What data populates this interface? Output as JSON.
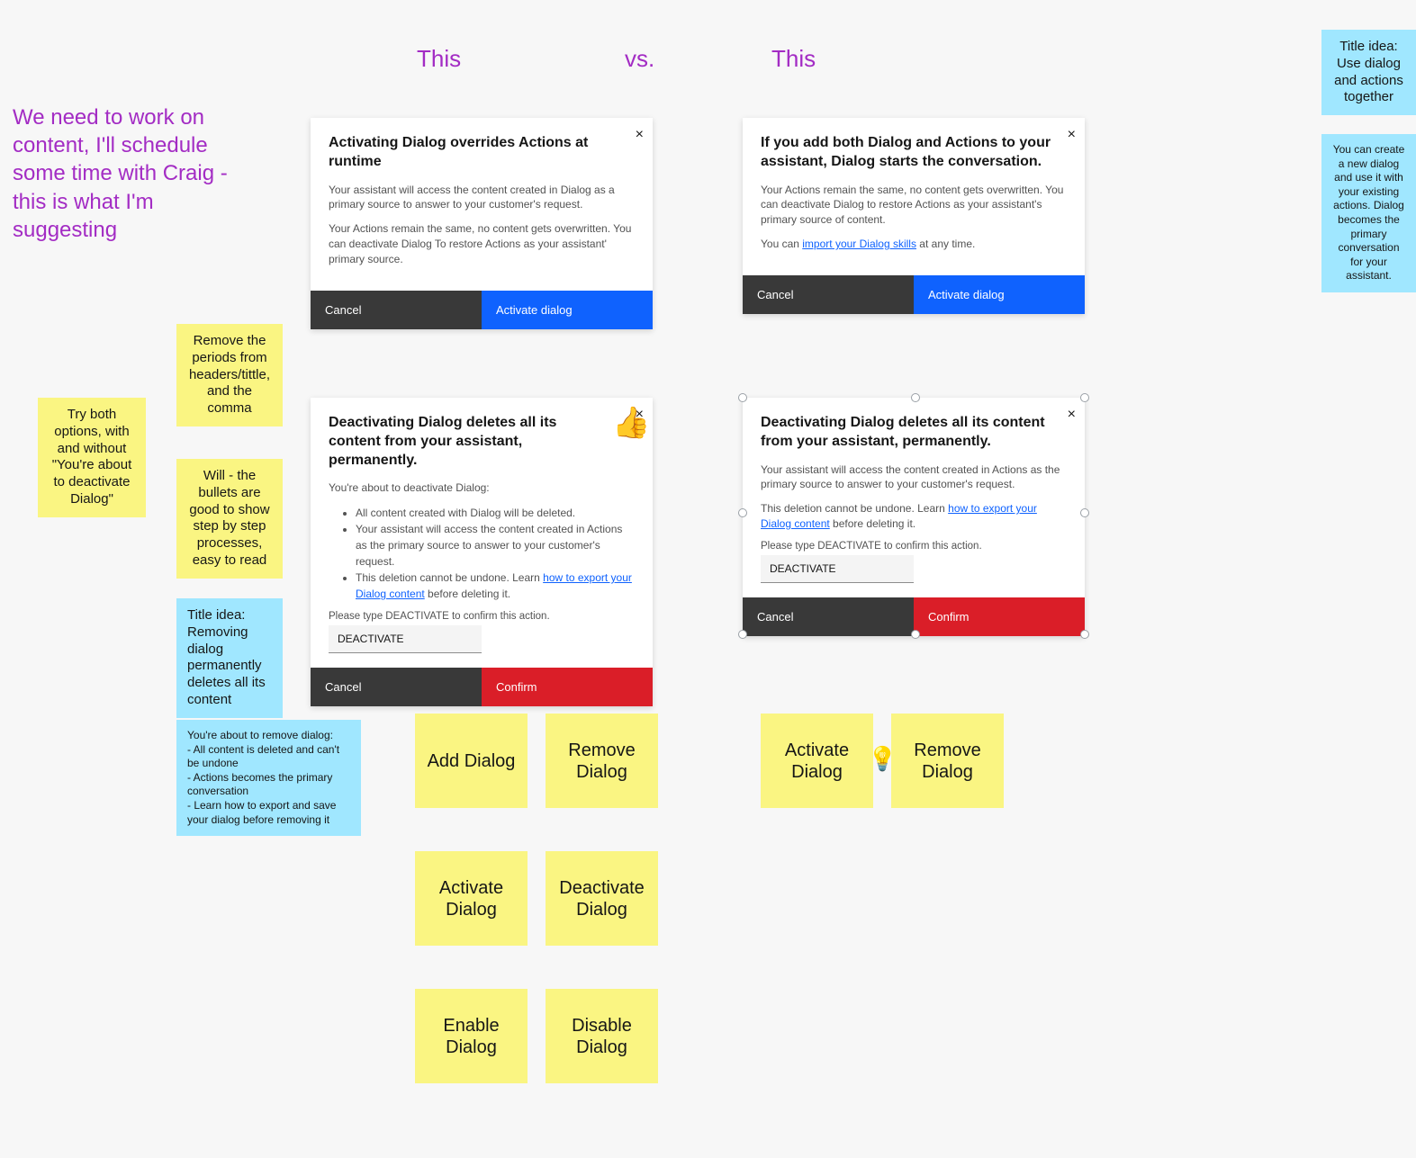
{
  "header": {
    "this_left": "This",
    "vs": "vs.",
    "this_right": "This"
  },
  "left_note": "We need to work on content, I'll schedule some time with Craig - this is what I'm suggesting",
  "sticky_title_right": "Title idea: Use dialog and actions together",
  "sticky_body_right": "You can create a new dialog and use it with your existing actions. Dialog becomes the primary conversation for your assistant.",
  "sticky_remove_periods": "Remove the periods from headers/tittle, and the comma",
  "sticky_try_both": "Try both options, with and without \"You're about to deactivate Dialog\"",
  "sticky_will_bullets": "Will - the bullets are good to show step by step processes, easy to read",
  "sticky_title_remove": "Title idea: Removing dialog permanently deletes all its content",
  "sticky_body_remove": "You're about to remove dialog:\n- All content is deleted and can't be undone\n- Actions becomes the primary conversation\n- Learn how to export and save your dialog before removing it",
  "modalA": {
    "title": "Activating Dialog overrides Actions at runtime",
    "p1": "Your assistant will access the content created in Dialog as a primary source to answer to your customer's request.",
    "p2": "Your Actions remain the same, no content gets overwritten. You can deactivate Dialog To restore Actions as your assistant' primary source.",
    "cancel": "Cancel",
    "primary": "Activate dialog"
  },
  "modalB": {
    "title": "If you add both Dialog and Actions to your assistant, Dialog starts the conversation.",
    "p1": "Your Actions remain the same, no content gets overwritten. You can deactivate Dialog to restore Actions as your assistant's primary source of content.",
    "p2a": "You can ",
    "p2link": "import your Dialog skills",
    "p2b": " at any time.",
    "cancel": "Cancel",
    "primary": "Activate dialog"
  },
  "modalC": {
    "title": "Deactivating Dialog deletes all its content from your assistant, permanently.",
    "lead": "You're about to deactivate Dialog:",
    "b1": "All content created with Dialog will be deleted.",
    "b2": "Your assistant will access the content created in Actions as the primary source to answer to your customer's request.",
    "b3a": "This deletion cannot be undone. Learn ",
    "b3link": "how to export your Dialog content",
    "b3b": " before deleting it.",
    "hint": "Please type DEACTIVATE to confirm this action.",
    "field": "DEACTIVATE",
    "cancel": "Cancel",
    "primary": "Confirm"
  },
  "modalD": {
    "title": "Deactivating Dialog deletes all its content from your assistant, permanently.",
    "p1": "Your assistant will access the content created in Actions as the primary source to answer to your customer's request.",
    "p2a": "This deletion cannot be undone. Learn ",
    "p2link": "how to export your Dialog content",
    "p2b": " before deleting it.",
    "hint": "Please type DEACTIVATE to confirm this action.",
    "field": "DEACTIVATE",
    "cancel": "Cancel",
    "primary": "Confirm"
  },
  "opts": {
    "add": "Add Dialog",
    "remove": "Remove Dialog",
    "activate": "Activate Dialog",
    "deactivate": "Deactivate Dialog",
    "enable": "Enable Dialog",
    "disable": "Disable Dialog",
    "activate2": "Activate Dialog",
    "remove2": "Remove Dialog"
  }
}
